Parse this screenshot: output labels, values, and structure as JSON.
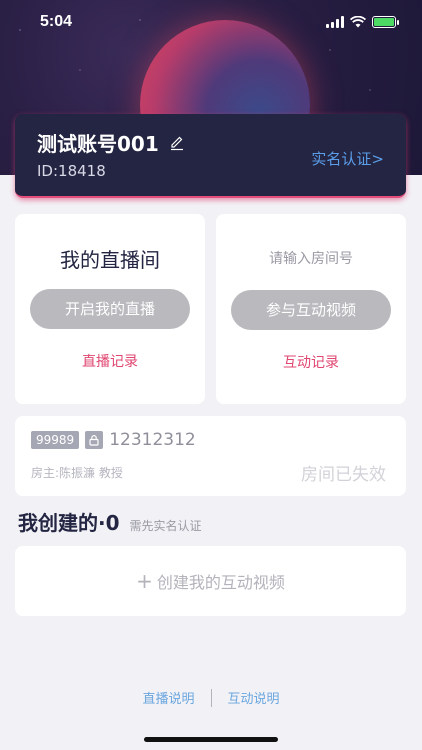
{
  "status_bar": {
    "time": "5:04"
  },
  "account": {
    "name": "测试账号001",
    "id_text": "ID:18418",
    "verify_label": "实名认证>"
  },
  "live_panel": {
    "heading": "我的直播间",
    "button_label": "开启我的直播",
    "record_label": "直播记录"
  },
  "interactive_panel": {
    "placeholder": "请输入房间号",
    "button_label": "参与互动视频",
    "record_label": "互动记录"
  },
  "room_card": {
    "tag": "99989",
    "room_number": "12312312",
    "owner_label": "房主:陈振濂 教授",
    "status": "房间已失效"
  },
  "created_section": {
    "title": "我创建的·0",
    "note": "需先实名认证"
  },
  "create_card": {
    "plus": "+",
    "label": "创建我的互动视频"
  },
  "footer": {
    "live_help": "直播说明",
    "interactive_help": "互动说明"
  },
  "colors": {
    "accent_pink": "#e04670",
    "link_blue": "#5b9de8",
    "card_dark": "#232542"
  }
}
